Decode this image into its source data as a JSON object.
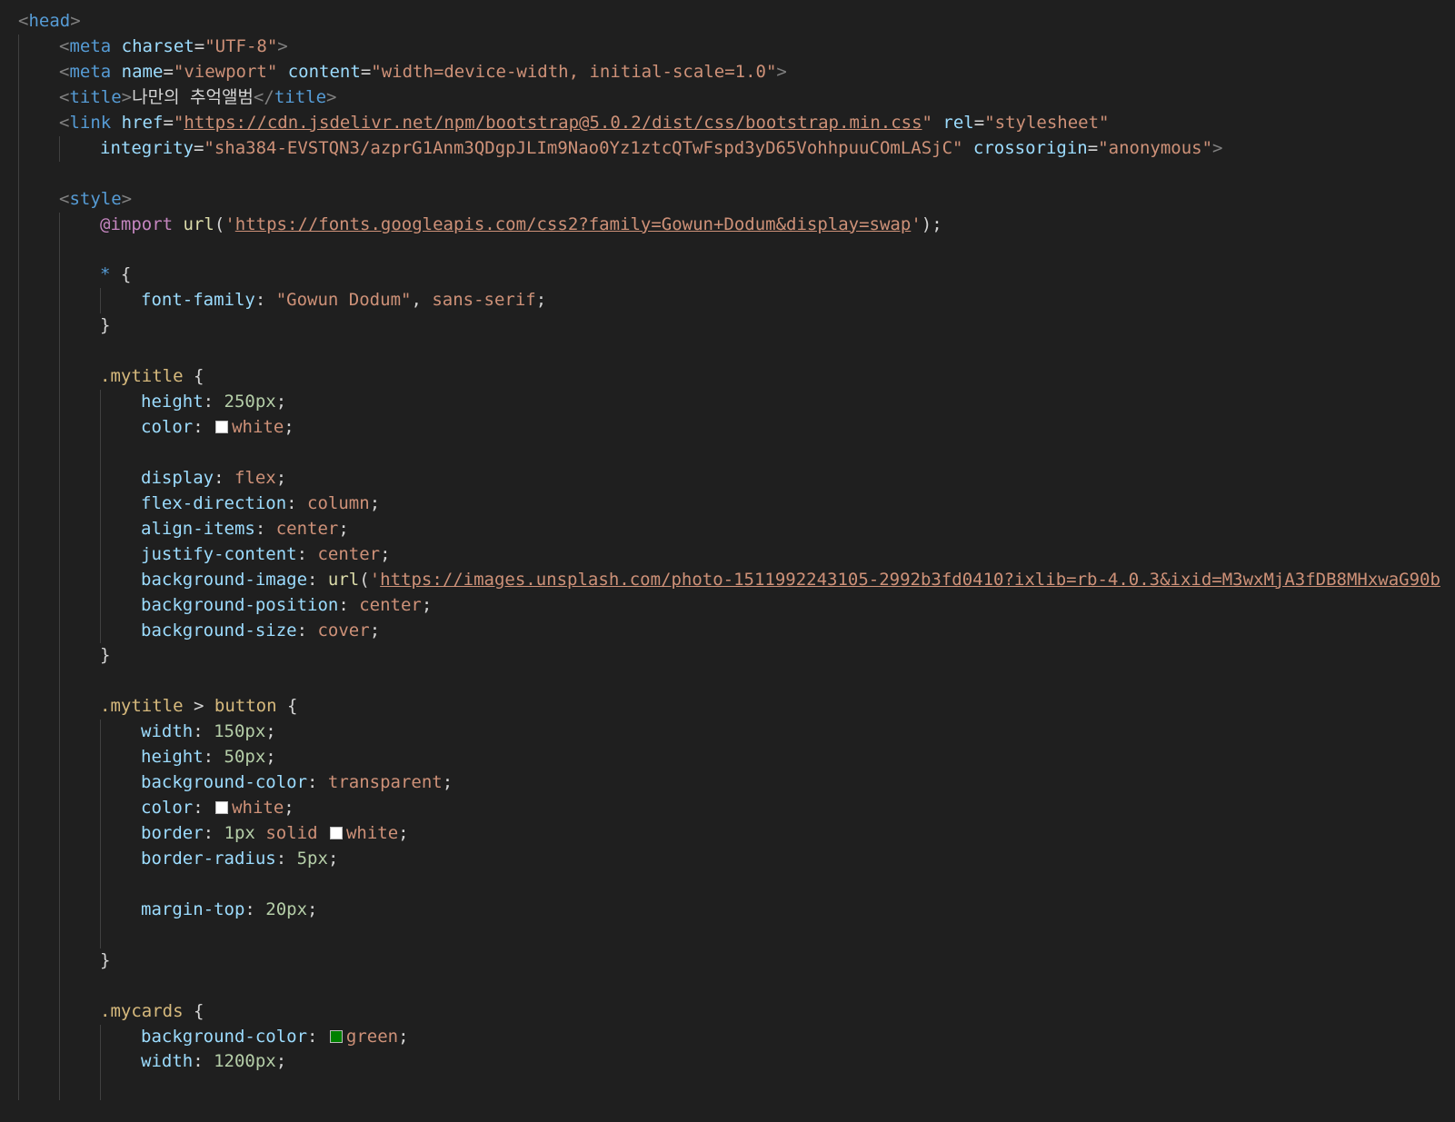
{
  "editor": {
    "theme_background": "#1f1f1f",
    "lines": [
      {
        "indent": 0,
        "tokens": [
          [
            "tag-bracket",
            "<"
          ],
          [
            "tag",
            "head"
          ],
          [
            "tag-bracket",
            ">"
          ]
        ]
      },
      {
        "indent": 1,
        "tokens": [
          [
            "tag-bracket",
            "<"
          ],
          [
            "tag",
            "meta"
          ],
          [
            "text",
            " "
          ],
          [
            "attr",
            "charset"
          ],
          [
            "punc",
            "="
          ],
          [
            "str",
            "\"UTF-8\""
          ],
          [
            "tag-bracket",
            ">"
          ]
        ]
      },
      {
        "indent": 1,
        "tokens": [
          [
            "tag-bracket",
            "<"
          ],
          [
            "tag",
            "meta"
          ],
          [
            "text",
            " "
          ],
          [
            "attr",
            "name"
          ],
          [
            "punc",
            "="
          ],
          [
            "str",
            "\"viewport\""
          ],
          [
            "text",
            " "
          ],
          [
            "attr",
            "content"
          ],
          [
            "punc",
            "="
          ],
          [
            "str",
            "\"width=device-width, initial-scale=1.0\""
          ],
          [
            "tag-bracket",
            ">"
          ]
        ]
      },
      {
        "indent": 1,
        "tokens": [
          [
            "tag-bracket",
            "<"
          ],
          [
            "tag",
            "title"
          ],
          [
            "tag-bracket",
            ">"
          ],
          [
            "text",
            "나만의 추억앨범"
          ],
          [
            "tag-bracket",
            "</"
          ],
          [
            "tag",
            "title"
          ],
          [
            "tag-bracket",
            ">"
          ]
        ]
      },
      {
        "indent": 1,
        "tokens": [
          [
            "tag-bracket",
            "<"
          ],
          [
            "tag",
            "link"
          ],
          [
            "text",
            " "
          ],
          [
            "attr",
            "href"
          ],
          [
            "punc",
            "="
          ],
          [
            "str",
            "\""
          ],
          [
            "link",
            "https://cdn.jsdelivr.net/npm/bootstrap@5.0.2/dist/css/bootstrap.min.css"
          ],
          [
            "str",
            "\""
          ],
          [
            "text",
            " "
          ],
          [
            "attr",
            "rel"
          ],
          [
            "punc",
            "="
          ],
          [
            "str",
            "\"stylesheet\""
          ]
        ]
      },
      {
        "indent": 2,
        "tokens": [
          [
            "attr",
            "integrity"
          ],
          [
            "punc",
            "="
          ],
          [
            "str",
            "\"sha384-EVSTQN3/azprG1Anm3QDgpJLIm9Nao0Yz1ztcQTwFspd3yD65VohhpuuCOmLASjC\""
          ],
          [
            "text",
            " "
          ],
          [
            "attr",
            "crossorigin"
          ],
          [
            "punc",
            "="
          ],
          [
            "str",
            "\"anonymous\""
          ],
          [
            "tag-bracket",
            ">"
          ]
        ]
      },
      {
        "indent": 1,
        "tokens": []
      },
      {
        "indent": 1,
        "tokens": [
          [
            "tag-bracket",
            "<"
          ],
          [
            "tag",
            "style"
          ],
          [
            "tag-bracket",
            ">"
          ]
        ]
      },
      {
        "indent": 2,
        "tokens": [
          [
            "atrule",
            "@import"
          ],
          [
            "text",
            " "
          ],
          [
            "func",
            "url"
          ],
          [
            "punc",
            "("
          ],
          [
            "str",
            "'"
          ],
          [
            "link",
            "https://fonts.googleapis.com/css2?family=Gowun+Dodum&display=swap"
          ],
          [
            "str",
            "'"
          ],
          [
            "punc",
            ");"
          ]
        ]
      },
      {
        "indent": 2,
        "tokens": []
      },
      {
        "indent": 2,
        "tokens": [
          [
            "univ",
            "*"
          ],
          [
            "text",
            " "
          ],
          [
            "punc",
            "{"
          ]
        ]
      },
      {
        "indent": 3,
        "tokens": [
          [
            "prop",
            "font-family"
          ],
          [
            "punc",
            ": "
          ],
          [
            "str",
            "\"Gowun Dodum\""
          ],
          [
            "punc",
            ", "
          ],
          [
            "val",
            "sans-serif"
          ],
          [
            "punc",
            ";"
          ]
        ]
      },
      {
        "indent": 2,
        "tokens": [
          [
            "punc",
            "}"
          ]
        ]
      },
      {
        "indent": 2,
        "tokens": []
      },
      {
        "indent": 2,
        "tokens": [
          [
            "sel",
            ".mytitle"
          ],
          [
            "text",
            " "
          ],
          [
            "punc",
            "{"
          ]
        ]
      },
      {
        "indent": 3,
        "tokens": [
          [
            "prop",
            "height"
          ],
          [
            "punc",
            ": "
          ],
          [
            "num",
            "250px"
          ],
          [
            "punc",
            ";"
          ]
        ]
      },
      {
        "indent": 3,
        "tokens": [
          [
            "prop",
            "color"
          ],
          [
            "punc",
            ": "
          ],
          [
            "swatch",
            "#ffffff"
          ],
          [
            "val",
            "white"
          ],
          [
            "punc",
            ";"
          ]
        ]
      },
      {
        "indent": 3,
        "tokens": []
      },
      {
        "indent": 3,
        "tokens": [
          [
            "prop",
            "display"
          ],
          [
            "punc",
            ": "
          ],
          [
            "val",
            "flex"
          ],
          [
            "punc",
            ";"
          ]
        ]
      },
      {
        "indent": 3,
        "tokens": [
          [
            "prop",
            "flex-direction"
          ],
          [
            "punc",
            ": "
          ],
          [
            "val",
            "column"
          ],
          [
            "punc",
            ";"
          ]
        ]
      },
      {
        "indent": 3,
        "tokens": [
          [
            "prop",
            "align-items"
          ],
          [
            "punc",
            ": "
          ],
          [
            "val",
            "center"
          ],
          [
            "punc",
            ";"
          ]
        ]
      },
      {
        "indent": 3,
        "tokens": [
          [
            "prop",
            "justify-content"
          ],
          [
            "punc",
            ": "
          ],
          [
            "val",
            "center"
          ],
          [
            "punc",
            ";"
          ]
        ]
      },
      {
        "indent": 3,
        "tokens": [
          [
            "prop",
            "background-image"
          ],
          [
            "punc",
            ": "
          ],
          [
            "func",
            "url"
          ],
          [
            "punc",
            "("
          ],
          [
            "str",
            "'"
          ],
          [
            "link",
            "https://images.unsplash.com/photo-1511992243105-2992b3fd0410?ixlib=rb-4.0.3&ixid=M3wxMjA3fDB8MHxwaG90b"
          ]
        ]
      },
      {
        "indent": 3,
        "tokens": [
          [
            "prop",
            "background-position"
          ],
          [
            "punc",
            ": "
          ],
          [
            "val",
            "center"
          ],
          [
            "punc",
            ";"
          ]
        ]
      },
      {
        "indent": 3,
        "tokens": [
          [
            "prop",
            "background-size"
          ],
          [
            "punc",
            ": "
          ],
          [
            "val",
            "cover"
          ],
          [
            "punc",
            ";"
          ]
        ]
      },
      {
        "indent": 2,
        "tokens": [
          [
            "punc",
            "}"
          ]
        ]
      },
      {
        "indent": 2,
        "tokens": []
      },
      {
        "indent": 2,
        "tokens": [
          [
            "sel",
            ".mytitle"
          ],
          [
            "text",
            " "
          ],
          [
            "punc",
            ">"
          ],
          [
            "text",
            " "
          ],
          [
            "sel",
            "button"
          ],
          [
            "text",
            " "
          ],
          [
            "punc",
            "{"
          ]
        ]
      },
      {
        "indent": 3,
        "tokens": [
          [
            "prop",
            "width"
          ],
          [
            "punc",
            ": "
          ],
          [
            "num",
            "150px"
          ],
          [
            "punc",
            ";"
          ]
        ]
      },
      {
        "indent": 3,
        "tokens": [
          [
            "prop",
            "height"
          ],
          [
            "punc",
            ": "
          ],
          [
            "num",
            "50px"
          ],
          [
            "punc",
            ";"
          ]
        ]
      },
      {
        "indent": 3,
        "tokens": [
          [
            "prop",
            "background-color"
          ],
          [
            "punc",
            ": "
          ],
          [
            "val",
            "transparent"
          ],
          [
            "punc",
            ";"
          ]
        ]
      },
      {
        "indent": 3,
        "tokens": [
          [
            "prop",
            "color"
          ],
          [
            "punc",
            ": "
          ],
          [
            "swatch",
            "#ffffff"
          ],
          [
            "val",
            "white"
          ],
          [
            "punc",
            ";"
          ]
        ]
      },
      {
        "indent": 3,
        "tokens": [
          [
            "prop",
            "border"
          ],
          [
            "punc",
            ": "
          ],
          [
            "num",
            "1px"
          ],
          [
            "text",
            " "
          ],
          [
            "val",
            "solid"
          ],
          [
            "text",
            " "
          ],
          [
            "swatch",
            "#ffffff"
          ],
          [
            "val",
            "white"
          ],
          [
            "punc",
            ";"
          ]
        ]
      },
      {
        "indent": 3,
        "tokens": [
          [
            "prop",
            "border-radius"
          ],
          [
            "punc",
            ": "
          ],
          [
            "num",
            "5px"
          ],
          [
            "punc",
            ";"
          ]
        ]
      },
      {
        "indent": 3,
        "tokens": []
      },
      {
        "indent": 3,
        "tokens": [
          [
            "prop",
            "margin-top"
          ],
          [
            "punc",
            ": "
          ],
          [
            "num",
            "20px"
          ],
          [
            "punc",
            ";"
          ]
        ]
      },
      {
        "indent": 3,
        "tokens": []
      },
      {
        "indent": 2,
        "tokens": [
          [
            "punc",
            "}"
          ]
        ]
      },
      {
        "indent": 2,
        "tokens": []
      },
      {
        "indent": 2,
        "tokens": [
          [
            "sel",
            ".mycards"
          ],
          [
            "text",
            " "
          ],
          [
            "punc",
            "{"
          ]
        ]
      },
      {
        "indent": 3,
        "tokens": [
          [
            "prop",
            "background-color"
          ],
          [
            "punc",
            ": "
          ],
          [
            "swatch",
            "#008000"
          ],
          [
            "val",
            "green"
          ],
          [
            "punc",
            ";"
          ]
        ]
      },
      {
        "indent": 3,
        "tokens": [
          [
            "prop",
            "width"
          ],
          [
            "punc",
            ": "
          ],
          [
            "num",
            "1200px"
          ],
          [
            "punc",
            ";"
          ]
        ]
      },
      {
        "indent": 3,
        "tokens": []
      }
    ]
  }
}
